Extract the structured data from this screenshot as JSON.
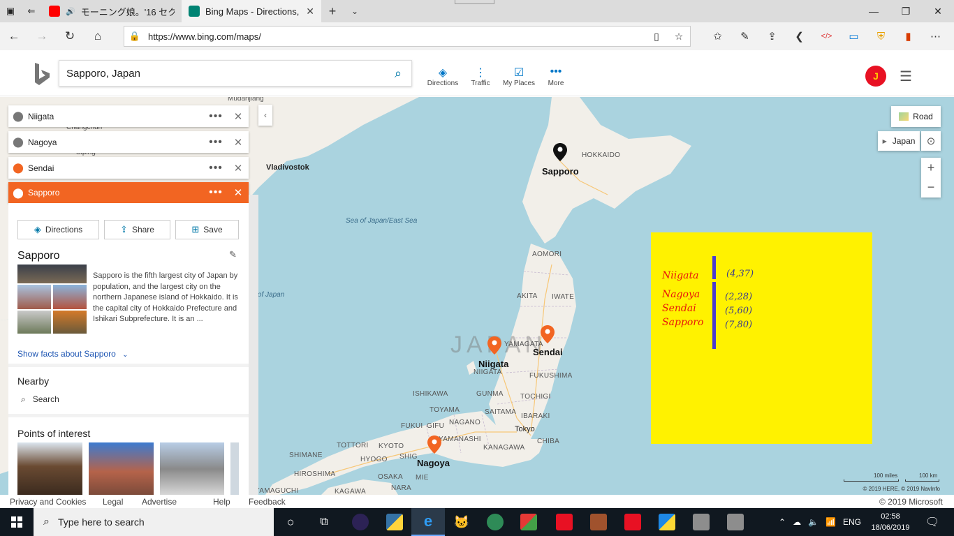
{
  "browser": {
    "tabs": [
      {
        "title": "モーニング娘。'16 セク",
        "icon": "youtube-icon",
        "color": "#ff0000"
      },
      {
        "title": "Bing Maps - Directions,",
        "icon": "bing-icon",
        "color": "#008373"
      }
    ],
    "url": "https://www.bing.com/maps/"
  },
  "bing": {
    "search_value": "Sapporo, Japan",
    "nav": [
      {
        "label": "Directions",
        "icon": "directions-icon"
      },
      {
        "label": "Traffic",
        "icon": "traffic-icon"
      },
      {
        "label": "My Places",
        "icon": "my-places-icon"
      },
      {
        "label": "More",
        "icon": "more-icon"
      }
    ]
  },
  "panel": {
    "waypoints": [
      {
        "name": "Niigata"
      },
      {
        "name": "Nagoya"
      },
      {
        "name": "Sendai"
      },
      {
        "name": "Sapporo"
      }
    ],
    "actions": [
      "Directions",
      "Share",
      "Save"
    ],
    "title": "Sapporo",
    "description": "Sapporo is the fifth largest city of Japan by population, and the largest city on the northern Japanese island of Hokkaido. It is the capital city of Hokkaido Prefecture and Ishikari Subprefecture. It is an ...",
    "facts_link": "Show facts about Sapporo",
    "nearby_heading": "Nearby",
    "nearby_search": "Search",
    "poi_heading": "Points of interest"
  },
  "map": {
    "labels": {
      "sapporo": "Sapporo",
      "niigata": "Niigata",
      "sendai": "Sendai",
      "nagoya": "Nagoya",
      "vladivostok": "Vladivostok",
      "hokkaido": "HOKKAIDO",
      "sea1": "Sea of Japan/East Sea",
      "sea2": "ea of Japan",
      "aomori": "AOMORI",
      "akita": "AKITA",
      "iwate": "IWATE",
      "yamagata": "YAMAGATA",
      "niigata_pref": "NIIGATA",
      "fukushima": "FUKUSHIMA",
      "ishikawa": "ISHIKAWA",
      "gunma": "GUNMA",
      "tochigi": "TOCHIGI",
      "toyama": "TOYAMA",
      "saitama": "SAITAMA",
      "ibaraki": "IBARAKI",
      "fukui": "FUKUI",
      "gifu": "GIFU",
      "nagano": "NAGANO",
      "tokyo": "Tokyo",
      "chiba": "CHIBA",
      "yamanashi": "YAMANASHI",
      "kanagawa": "KANAGAWA",
      "tottori": "TOTTORI",
      "kyoto": "KYOTO",
      "shimane": "SHIMANE",
      "hyogo": "HYOGO",
      "shiga": "SHIG",
      "hiroshima": "HIROSHIMA",
      "osaka": "OSAKA",
      "mie": "MIE",
      "nara": "NARA",
      "yamaguchi": "YAMAGUCHI",
      "kagawa": "KAGAWA",
      "japan_watermark": "JAPAN",
      "changchun": "Changchun",
      "siping": "Siping",
      "mudanjiang": "Mudanjiang"
    },
    "controls": {
      "road": "Road",
      "region": "Japan"
    },
    "scale_miles": "100 miles",
    "scale_km": "100 km",
    "copyright": "© 2019 HERE, © 2019 NavInfo"
  },
  "overlay": {
    "background": "#fff200",
    "names": [
      "Niigata",
      "Nagoya",
      "Sendai",
      "Sapporo"
    ],
    "values": [
      "(4,37)",
      "(2,28)",
      "(5,60)",
      "(7,80)"
    ]
  },
  "footer": {
    "links": [
      "Privacy and Cookies",
      "Legal",
      "Advertise",
      "Help",
      "Feedback"
    ],
    "copyright": "© 2019 Microsoft"
  },
  "taskbar": {
    "search_placeholder": "Type here to search",
    "language": "ENG",
    "time": "02:58",
    "date": "18/06/2019"
  }
}
